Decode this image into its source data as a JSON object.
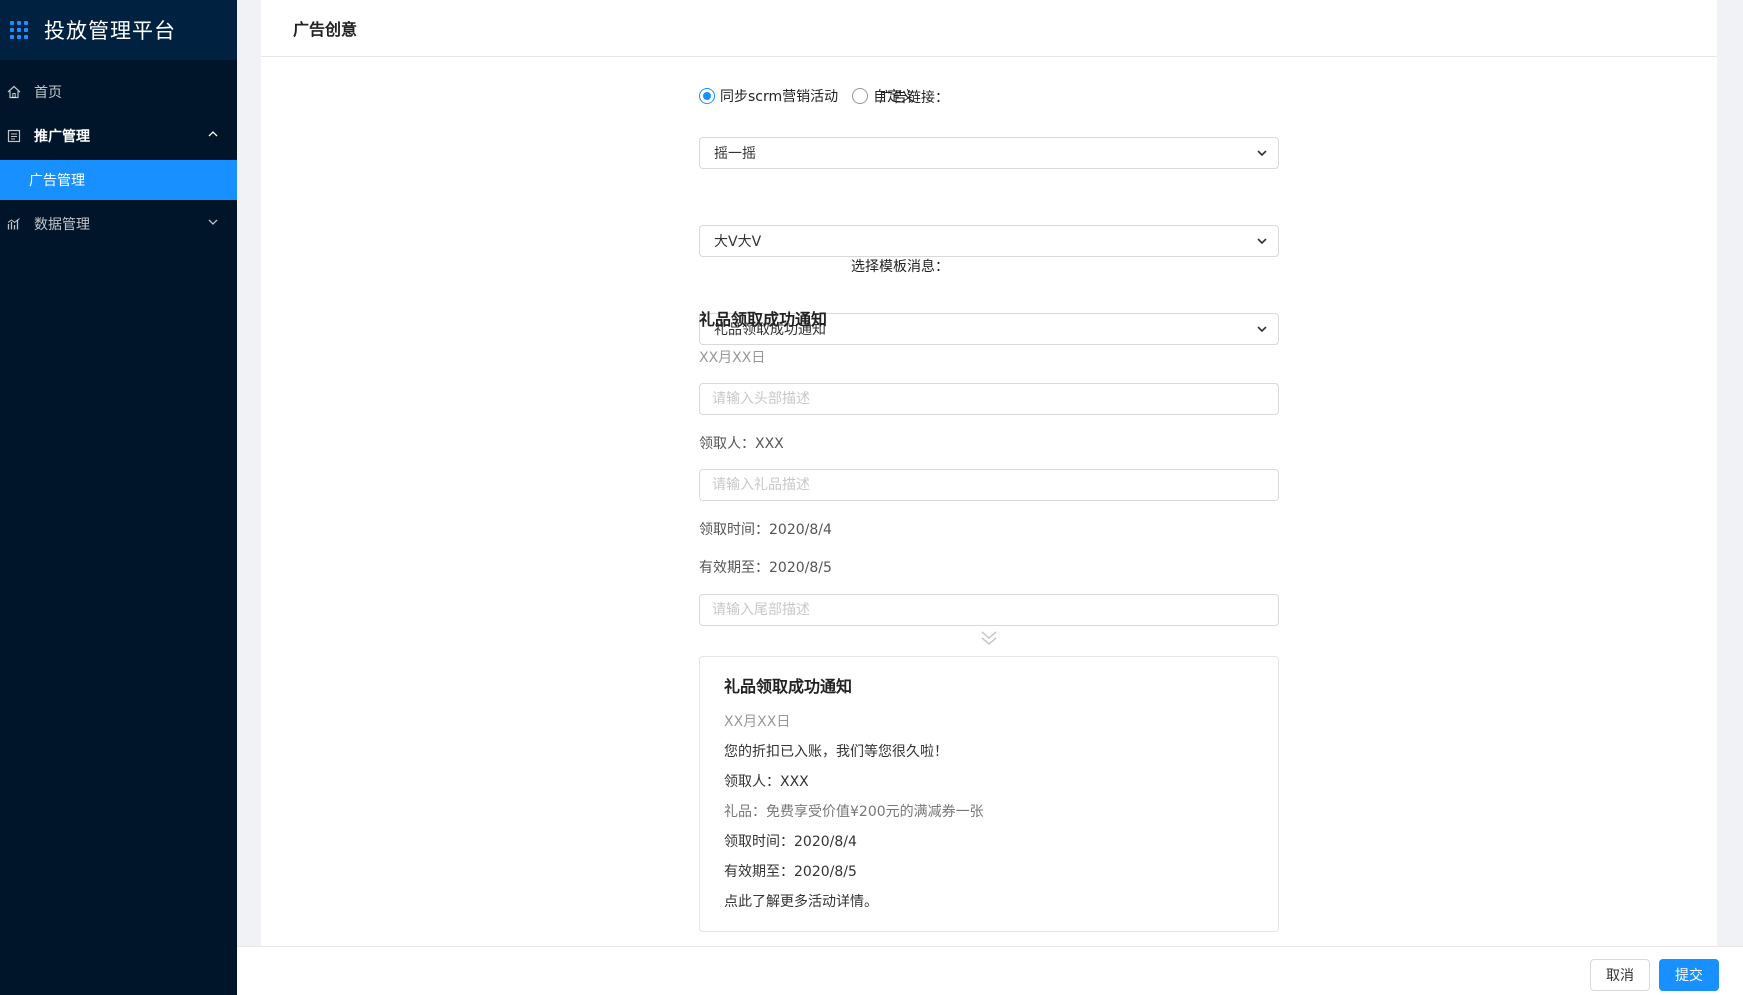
{
  "app": {
    "title": "投放管理平台"
  },
  "sidebar": {
    "items": [
      {
        "label": "首页",
        "icon": "home-icon"
      },
      {
        "label": "推广管理",
        "icon": "document-icon",
        "expanded": true
      },
      {
        "label": "广告管理",
        "active": true
      },
      {
        "label": "数据管理",
        "icon": "chart-icon",
        "expanded": false
      }
    ]
  },
  "main": {
    "title": "广告创意",
    "ad_link": {
      "label": "广告链接：",
      "options": [
        "同步scrm营销活动",
        "自定义"
      ],
      "selected": "同步scrm营销活动"
    },
    "activity_select": "摇一摇",
    "activity_name_select": "大V大V",
    "template": {
      "label": "选择模板消息：",
      "value": "礼品领取成功通知"
    },
    "template_body": {
      "title": "礼品领取成功通知",
      "date": "XX月XX日",
      "header_placeholder": "请输入头部描述",
      "receiver": "领取人：XXX",
      "gift_placeholder": "请输入礼品描述",
      "receive_time": "领取时间：2020/8/4",
      "valid_until": "有效期至：2020/8/5",
      "footer_placeholder": "请输入尾部描述"
    },
    "preview": {
      "title": "礼品领取成功通知",
      "date": "XX月XX日",
      "header": "您的折扣已入账，我们等您很久啦！",
      "receiver": "领取人：XXX",
      "gift": "礼品：免费享受价值¥200元的满减券一张",
      "receive_time": "领取时间：2020/8/4",
      "valid_until": "有效期至：2020/8/5",
      "footer": "点此了解更多活动详情。"
    }
  },
  "footer": {
    "cancel_label": "取消",
    "submit_label": "提交"
  },
  "colors": {
    "sidebar_bg": "#001529",
    "brand_bg": "#002140",
    "accent": "#1890ff"
  }
}
